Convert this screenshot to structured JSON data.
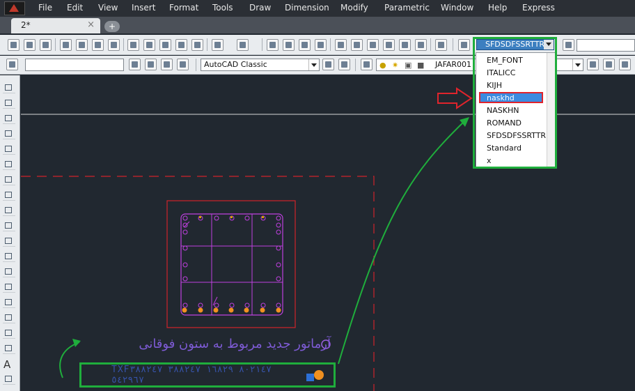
{
  "menu": {
    "items": [
      "File",
      "Edit",
      "View",
      "Insert",
      "Format",
      "Tools",
      "Draw",
      "Dimension",
      "Modify",
      "Parametric",
      "Window",
      "Help",
      "Express"
    ]
  },
  "tabs": [
    {
      "label": "2*"
    }
  ],
  "toolbar2": {
    "workspace_value": "AutoCAD Classic",
    "layer_value": "JAFAR001"
  },
  "text_style": {
    "current_value": "SFDSDFSSRTTR",
    "options": [
      "EM_FONT",
      "ITALICC",
      "KIJH",
      "naskhd",
      "NASKHN",
      "ROMAND",
      "SFDSDFSSRTTR",
      "Standard",
      "x"
    ],
    "highlighted_option": "naskhd"
  },
  "annotations": {
    "persian_note": "آرماتور جدید مربوط به ستون فوقانی",
    "bottom_text": "TXF٨٠٢١٤٧ ١٦٨٢٩ ٣٨٨٢٤٧ ٣٨٨٢٤٧ ٥٤٢٩٦٧"
  },
  "colors": {
    "canvas_bg": "#212830",
    "highlight_blue": "#3b8be0",
    "annotation_green": "#1fae3c",
    "red_marker": "#e0242c",
    "column_magenta": "#c040e0"
  },
  "icons": [
    "app-icon",
    "new-icon",
    "open-icon",
    "save-icon",
    "print-icon",
    "cut-icon",
    "copy-icon",
    "paste-icon",
    "undo-icon",
    "redo-icon",
    "pan-icon",
    "zoom-icon",
    "properties-icon",
    "help-icon",
    "text-style-icon",
    "line-icon",
    "circle-icon",
    "arc-icon",
    "polygon-icon",
    "rectangle-icon",
    "hatch-icon",
    "table-icon",
    "text-icon"
  ]
}
